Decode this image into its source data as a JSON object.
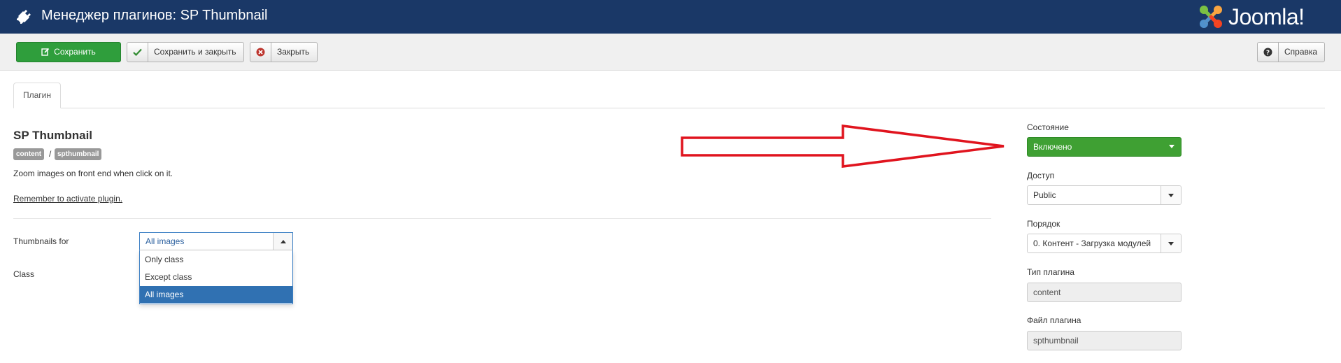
{
  "header": {
    "title": "Менеджер плагинов: SP Thumbnail",
    "title_icon": "plug-icon",
    "logo_text": "Joomla!",
    "logo_icon": "joomla-logo-icon"
  },
  "toolbar": {
    "save_label": "Сохранить",
    "save_close_label": "Сохранить и закрыть",
    "close_label": "Закрыть",
    "help_label": "Справка",
    "save_color": "#2f9e3c"
  },
  "tabs": [
    {
      "label": "Плагин",
      "active": true
    }
  ],
  "main": {
    "plugin_name": "SP Thumbnail",
    "badges": [
      "content",
      "spthumbnail"
    ],
    "badge_separator": "/",
    "description": "Zoom images on front end when click on it.",
    "reminder": "Remember to activate plugin.",
    "fields": {
      "thumbnails_for": {
        "label": "Thumbnails for",
        "selected": "All images",
        "options": [
          "Only class",
          "Except class",
          "All images"
        ],
        "highlighted_option": "All images"
      },
      "class": {
        "label": "Class"
      }
    }
  },
  "sidebar": {
    "state": {
      "label": "Состояние",
      "value": "Включено",
      "color": "#3fa033"
    },
    "access": {
      "label": "Доступ",
      "value": "Public"
    },
    "ordering": {
      "label": "Порядок",
      "value": "0. Контент - Загрузка модулей"
    },
    "plugin_type": {
      "label": "Тип плагина",
      "value": "content"
    },
    "plugin_file": {
      "label": "Файл плагина",
      "value": "spthumbnail"
    }
  },
  "annotation": {
    "arrow_color": "#e0141e"
  }
}
